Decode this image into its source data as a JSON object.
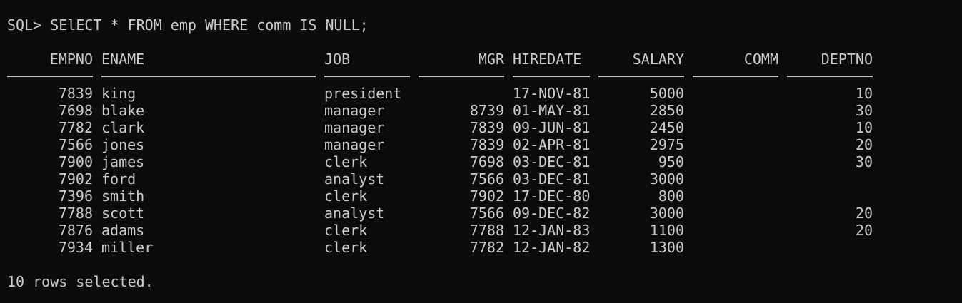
{
  "terminal": {
    "prompt": "SQL> SElECT * FROM emp WHERE comm IS NULL;",
    "footer": "10 rows selected."
  },
  "table": {
    "headers": [
      "EMPNO",
      "ENAME",
      "JOB",
      "MGR",
      "HIREDATE",
      "SALARY",
      "COMM",
      "DEPTNO"
    ],
    "rows": [
      [
        "7839",
        "king",
        "president",
        "",
        "17-NOV-81",
        "5000",
        "",
        "10"
      ],
      [
        "7698",
        "blake",
        "manager",
        "8739",
        "01-MAY-81",
        "2850",
        "",
        "30"
      ],
      [
        "7782",
        "clark",
        "manager",
        "7839",
        "09-JUN-81",
        "2450",
        "",
        "10"
      ],
      [
        "7566",
        "jones",
        "manager",
        "7839",
        "02-APR-81",
        "2975",
        "",
        "20"
      ],
      [
        "7900",
        "james",
        "clerk",
        "7698",
        "03-DEC-81",
        "950",
        "",
        "30"
      ],
      [
        "7902",
        "ford",
        "analyst",
        "7566",
        "03-DEC-81",
        "3000",
        "",
        ""
      ],
      [
        "7396",
        "smith",
        "clerk",
        "7902",
        "17-DEC-80",
        "800",
        "",
        ""
      ],
      [
        "7788",
        "scott",
        "analyst",
        "7566",
        "09-DEC-82",
        "3000",
        "",
        "20"
      ],
      [
        "7876",
        "adams",
        "clerk",
        "7788",
        "12-JAN-83",
        "1100",
        "",
        "20"
      ],
      [
        "7934",
        "miller",
        "clerk",
        "7782",
        "12-JAN-82",
        "1300",
        "",
        ""
      ]
    ]
  }
}
